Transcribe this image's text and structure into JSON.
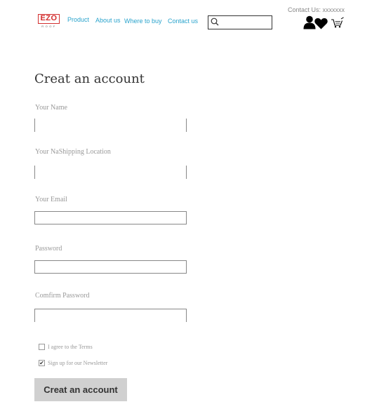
{
  "header": {
    "logo_text": "EZO",
    "logo_sub": "ROOF",
    "nav": [
      "Product",
      "About us",
      "Where to buy",
      "Contact us"
    ],
    "search_value": "",
    "contact_line": "Contact Us: xxxxxxx",
    "icons": [
      "account-icon",
      "favorites-icon",
      "cart-icon"
    ],
    "brand_color": "#d32f2f",
    "nav_color": "#29a3cc"
  },
  "form": {
    "title": "Creat an account",
    "labels": {
      "name": "Your Name",
      "location": "Your NaShipping Location",
      "email": "Your Email",
      "password": "Password",
      "confirm": "Comfirm Password"
    },
    "values": {
      "name": "",
      "location": "",
      "email": "",
      "password": "",
      "confirm": ""
    },
    "checkboxes": [
      {
        "label": "I agree to the Terms",
        "checked": false
      },
      {
        "label": "Sign up for our Newsletter",
        "checked": true
      }
    ],
    "submit_label": "Creat an account"
  }
}
